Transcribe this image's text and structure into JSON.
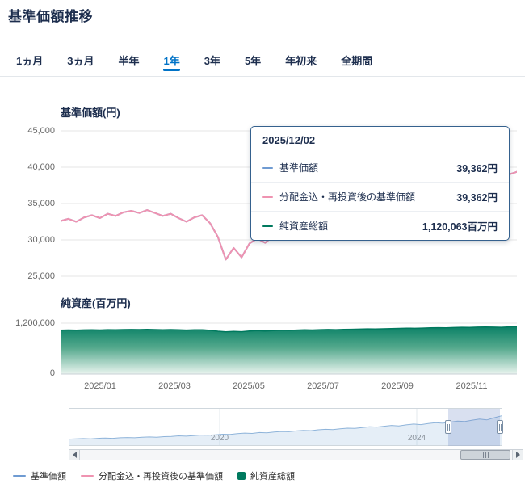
{
  "page": {
    "title": "基準価額推移"
  },
  "tabs": [
    {
      "label": "1ヵ月",
      "active": false
    },
    {
      "label": "3ヵ月",
      "active": false
    },
    {
      "label": "半年",
      "active": false
    },
    {
      "label": "1年",
      "active": true
    },
    {
      "label": "3年",
      "active": false
    },
    {
      "label": "5年",
      "active": false
    },
    {
      "label": "年初来",
      "active": false
    },
    {
      "label": "全期間",
      "active": false
    }
  ],
  "price_chart": {
    "label": "基準価額(円)",
    "yticks": [
      "45,000",
      "40,000",
      "35,000",
      "30,000",
      "25,000"
    ]
  },
  "asset_chart": {
    "label": "純資産(百万円)",
    "yticks": [
      "1,200,000",
      "0"
    ]
  },
  "xaxis": {
    "labels": [
      "2025/01",
      "2025/03",
      "2025/05",
      "2025/07",
      "2025/09",
      "2025/11"
    ]
  },
  "tooltip": {
    "date": "2025/12/02",
    "rows": [
      {
        "label": "基準価額",
        "value": "39,362円",
        "color": "#6f9bd2"
      },
      {
        "label": "分配金込・再投資後の基準価額",
        "value": "39,362円",
        "color": "#ef93b1"
      },
      {
        "label": "純資産総額",
        "value": "1,120,063百万円",
        "color": "#00795e"
      }
    ]
  },
  "navigator": {
    "labels": [
      "2020",
      "2024"
    ]
  },
  "legend": [
    {
      "label": "基準価額",
      "color": "#6f9bd2",
      "marker": "line"
    },
    {
      "label": "分配金込・再投資後の基準価額",
      "color": "#ef93b1",
      "marker": "line"
    },
    {
      "label": "純資産総額",
      "color": "#00795e",
      "marker": "square"
    }
  ],
  "colors": {
    "accent": "#0173c7",
    "grid": "#e6e6e6",
    "axis_text": "#666666",
    "tooltip_border": "#35618e"
  },
  "chart_data": [
    {
      "type": "line",
      "title": "基準価額(円)",
      "ylabel": "基準価額(円)",
      "ylim": [
        25000,
        45000
      ],
      "yticks": [
        45000,
        40000,
        35000,
        30000,
        25000
      ],
      "x_start": "2024/12",
      "x_end": "2025/12/02",
      "x_tick_labels": [
        "2025/01",
        "2025/03",
        "2025/05",
        "2025/07",
        "2025/09",
        "2025/11"
      ],
      "grid": true,
      "series": [
        {
          "name": "基準価額",
          "color": "#6f9bd2",
          "last_point": {
            "date": "2025/12/02",
            "value": 39362
          },
          "values": [
            32600,
            32900,
            32500,
            33100,
            33400,
            33000,
            33600,
            33300,
            33800,
            34000,
            33700,
            34100,
            33700,
            33300,
            33600,
            33000,
            32500,
            33100,
            33400,
            32300,
            30400,
            27300,
            28900,
            27600,
            29500,
            30200,
            29600,
            30500,
            31100,
            30800,
            31500,
            32000,
            31700,
            32400,
            32800,
            32500,
            33100,
            33500,
            33900,
            34300,
            34000,
            34700,
            35200,
            35700,
            36100,
            35800,
            36400,
            36900,
            37400,
            37100,
            37800,
            38300,
            38000,
            38600,
            39100,
            38700,
            38300,
            39000,
            39362
          ]
        },
        {
          "name": "分配金込・再投資後の基準価額",
          "color": "#ef93b1",
          "last_point": {
            "date": "2025/12/02",
            "value": 39362
          },
          "values": [
            32600,
            32900,
            32500,
            33100,
            33400,
            33000,
            33600,
            33300,
            33800,
            34000,
            33700,
            34100,
            33700,
            33300,
            33600,
            33000,
            32500,
            33100,
            33400,
            32300,
            30400,
            27300,
            28900,
            27600,
            29500,
            30200,
            29600,
            30500,
            31100,
            30800,
            31500,
            32000,
            31700,
            32400,
            32800,
            32500,
            33100,
            33500,
            33900,
            34300,
            34000,
            34700,
            35200,
            35700,
            36100,
            35800,
            36400,
            36900,
            37400,
            37100,
            37800,
            38300,
            38000,
            38600,
            39100,
            38700,
            38300,
            39000,
            39362
          ]
        }
      ]
    },
    {
      "type": "area",
      "title": "純資産(百万円)",
      "ylabel": "純資産(百万円)",
      "ylim": [
        0,
        1200000
      ],
      "yticks": [
        1200000,
        0
      ],
      "x_start": "2024/12",
      "x_end": "2025/12/02",
      "series": [
        {
          "name": "純資産総額",
          "color": "#00795e",
          "last_point": {
            "date": "2025/12/02",
            "value": 1120063
          },
          "values": [
            1035000,
            1038000,
            1033000,
            1040000,
            1043000,
            1039000,
            1045000,
            1042000,
            1048000,
            1050000,
            1047000,
            1051000,
            1048000,
            1044000,
            1047000,
            1042000,
            1036000,
            1041000,
            1044000,
            1030000,
            1010000,
            995000,
            1005000,
            998000,
            1015000,
            1022000,
            1016000,
            1025000,
            1032000,
            1028000,
            1036000,
            1041000,
            1038000,
            1045000,
            1049000,
            1046000,
            1052000,
            1056000,
            1060000,
            1064000,
            1061000,
            1067000,
            1072000,
            1077000,
            1081000,
            1078000,
            1084000,
            1089000,
            1094000,
            1091000,
            1098000,
            1103000,
            1100000,
            1106000,
            1111000,
            1107000,
            1103000,
            1112000,
            1120063
          ]
        }
      ]
    },
    {
      "type": "line",
      "title": "navigator (全期間ミニチャート)",
      "x_labels": [
        "2020",
        "2024"
      ],
      "ylim": [
        0,
        1
      ],
      "selected_range": "直近1年",
      "series": [
        {
          "name": "基準価額(全期間・正規化)",
          "color": "#8fb4da",
          "values": [
            0.1,
            0.11,
            0.12,
            0.11,
            0.13,
            0.14,
            0.13,
            0.15,
            0.16,
            0.15,
            0.17,
            0.18,
            0.17,
            0.19,
            0.2,
            0.22,
            0.21,
            0.23,
            0.25,
            0.24,
            0.26,
            0.28,
            0.27,
            0.3,
            0.32,
            0.31,
            0.34,
            0.33,
            0.36,
            0.38,
            0.37,
            0.4,
            0.42,
            0.41,
            0.44,
            0.46,
            0.45,
            0.48,
            0.5,
            0.49,
            0.52,
            0.55,
            0.54,
            0.57,
            0.6,
            0.58,
            0.62,
            0.65,
            0.63,
            0.67,
            0.7,
            0.68,
            0.72,
            0.76,
            0.74,
            0.79,
            0.83,
            0.8,
            0.88,
            0.95
          ]
        }
      ]
    }
  ]
}
